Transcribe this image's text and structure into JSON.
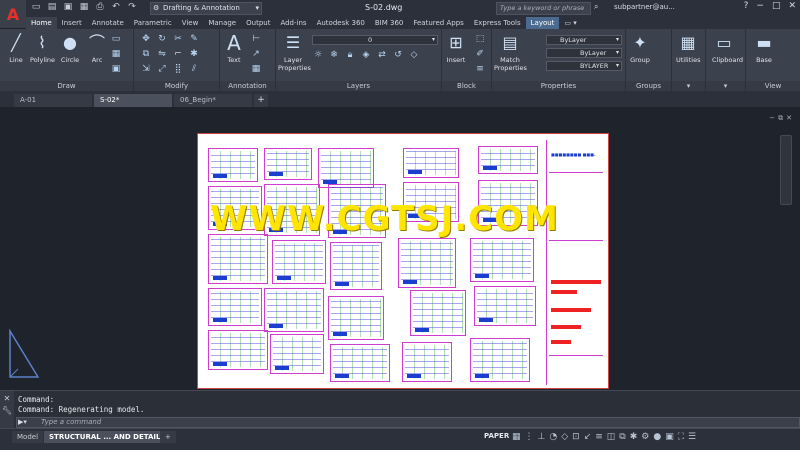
{
  "app": {
    "doc_title": "S-02.dwg",
    "workspace": "Drafting & Annotation",
    "search_placeholder": "Type a keyword or phrase",
    "user": "subpartner@au...",
    "logo": "A"
  },
  "ribbon_tabs": [
    "Home",
    "Insert",
    "Annotate",
    "Parametric",
    "View",
    "Manage",
    "Output",
    "Add-ins",
    "Autodesk 360",
    "BIM 360",
    "Featured Apps",
    "Express Tools",
    "Layout"
  ],
  "draw_panel": {
    "title": "Draw",
    "tools": [
      "Line",
      "Polyline",
      "Circle",
      "Arc"
    ]
  },
  "modify_panel": {
    "title": "Modify"
  },
  "annotation_panel": {
    "title": "Annotation",
    "text_label": "Text"
  },
  "layers_panel": {
    "title": "Layers",
    "layer_props": "Layer Properties",
    "current_layer": "0"
  },
  "block_panel": {
    "title": "Block",
    "insert_label": "Insert"
  },
  "properties_panel": {
    "title": "Properties",
    "match_label": "Match Properties",
    "color": "ByLayer",
    "linetype": "ByLayer",
    "lineweight": "BYLAYER"
  },
  "groups_panel": {
    "title": "Groups",
    "group_label": "Group"
  },
  "utilities": {
    "label": "Utilities"
  },
  "clipboard": {
    "label": "Clipboard"
  },
  "view_panel": {
    "title": "View",
    "base_label": "Base"
  },
  "file_tabs": [
    "A-01",
    "S-02*",
    "06_Begin*"
  ],
  "watermark": "WWW.CGTSJ.COM",
  "command": {
    "line1": "Command:",
    "line2": "Command: Regenerating model.",
    "placeholder": "Type a command"
  },
  "layout_tabs": [
    "Model",
    "STRUCTURAL ... AND DETAILS"
  ],
  "status": {
    "paper": "PAPER"
  },
  "colors": {
    "accent": "#4a6b8f",
    "watermark": "#ffe500",
    "viewport_border": "#d03cd0"
  }
}
